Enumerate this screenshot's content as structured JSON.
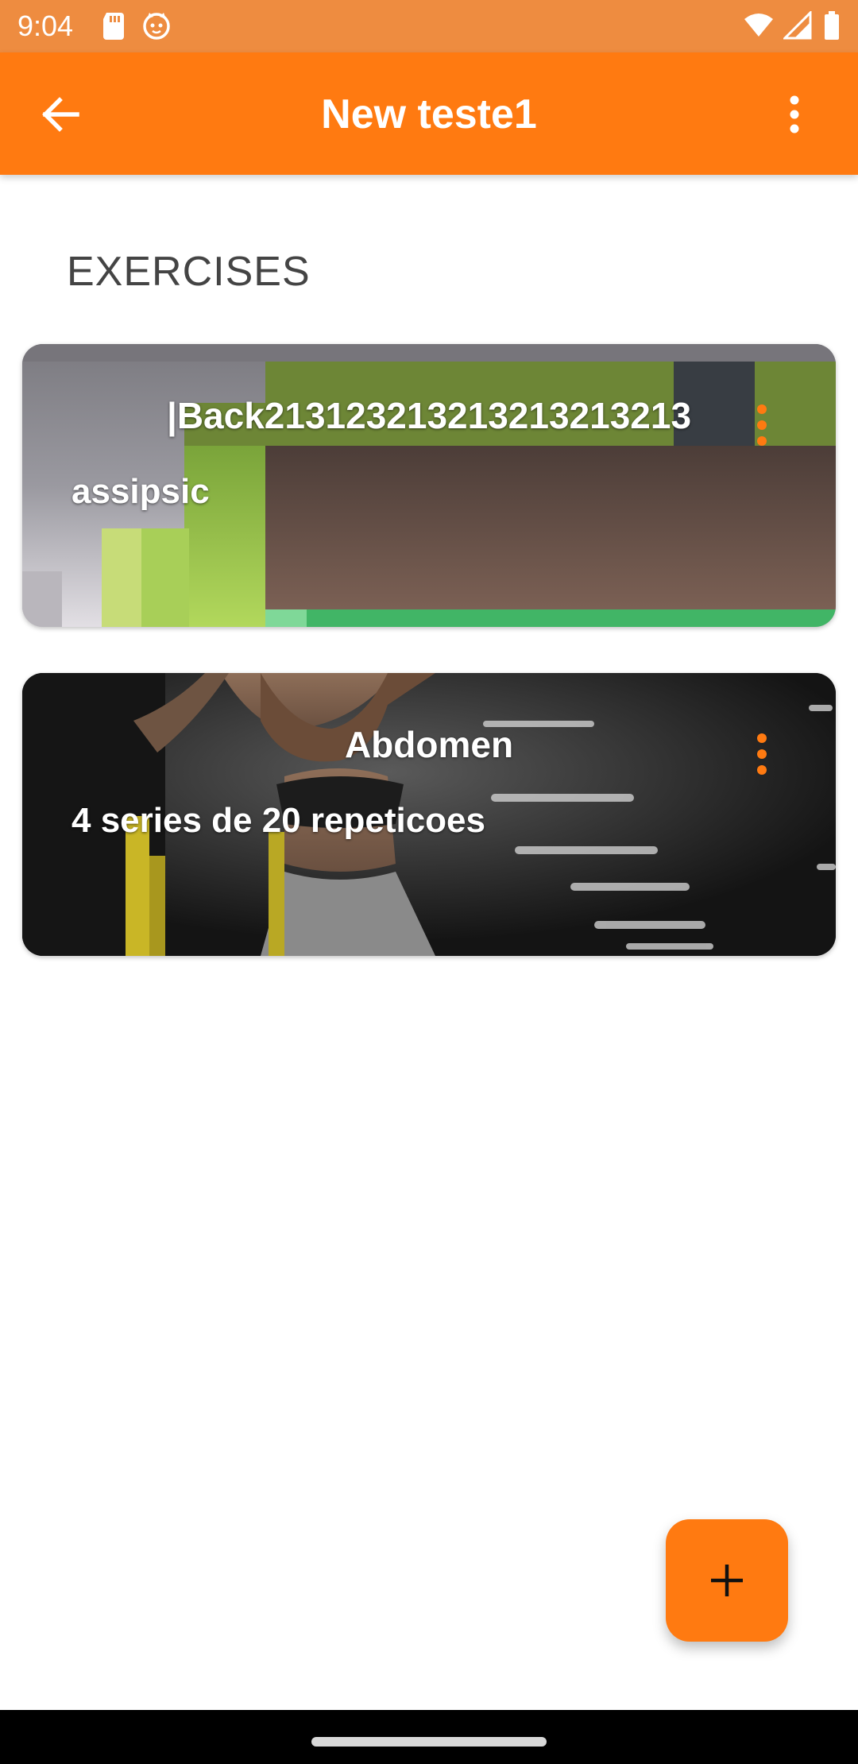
{
  "status_bar": {
    "time": "9:04",
    "left_icons": [
      "sd-card-icon",
      "cat-notification-icon"
    ],
    "right_icons": [
      "wifi-icon",
      "signal-icon",
      "battery-icon"
    ],
    "color": "#EE8C40"
  },
  "app_bar": {
    "title": "New teste1",
    "back_icon": "arrow-left-icon",
    "menu_icon": "more-vert-icon",
    "color": "#FF7A11"
  },
  "section": {
    "title": "EXERCISES"
  },
  "exercises": [
    {
      "title": "|Back213123213213213213213",
      "description": "assipsic",
      "menu_icon": "more-vert-icon"
    },
    {
      "title": "Abdomen",
      "description": "4 series de 20 repeticoes",
      "menu_icon": "more-vert-icon"
    }
  ],
  "fab": {
    "icon": "plus-icon",
    "color": "#FF7A11"
  },
  "accent_color": "#FF7A11"
}
